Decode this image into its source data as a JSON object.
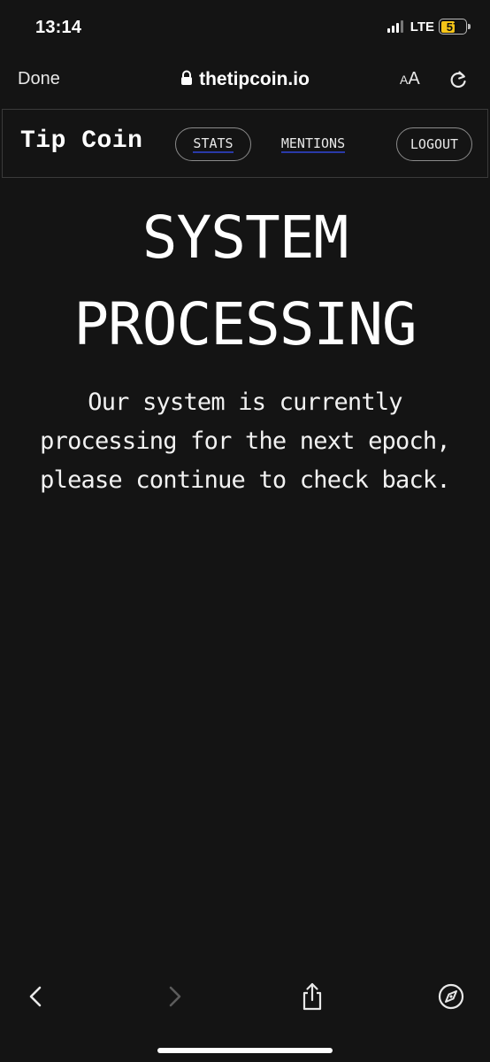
{
  "status_bar": {
    "time": "13:14",
    "network": "LTE",
    "battery": "57",
    "battery_color": "#f5c518"
  },
  "browser": {
    "done_label": "Done",
    "url": "thetipcoin.io",
    "text_size_label_small": "A",
    "text_size_label_large": "A",
    "icons": [
      "lock-icon",
      "reload-icon"
    ]
  },
  "site_nav": {
    "logo": "Tip Coin",
    "links": [
      {
        "label": "STATS"
      },
      {
        "label": "MENTIONS"
      },
      {
        "label": "LOGOUT"
      }
    ]
  },
  "main": {
    "headline_line1": "SYSTEM",
    "headline_line2": "PROCESSING",
    "message_line1": "Our system is currently",
    "message_line2": "processing for the next epoch,",
    "message_line3": "please continue to check back."
  },
  "toolbar": {
    "icons": [
      "back-icon",
      "forward-icon",
      "share-icon",
      "compass-icon"
    ]
  },
  "colors": {
    "background": "#141414",
    "text": "#ffffff",
    "link_underline": "#2a3aa8"
  }
}
